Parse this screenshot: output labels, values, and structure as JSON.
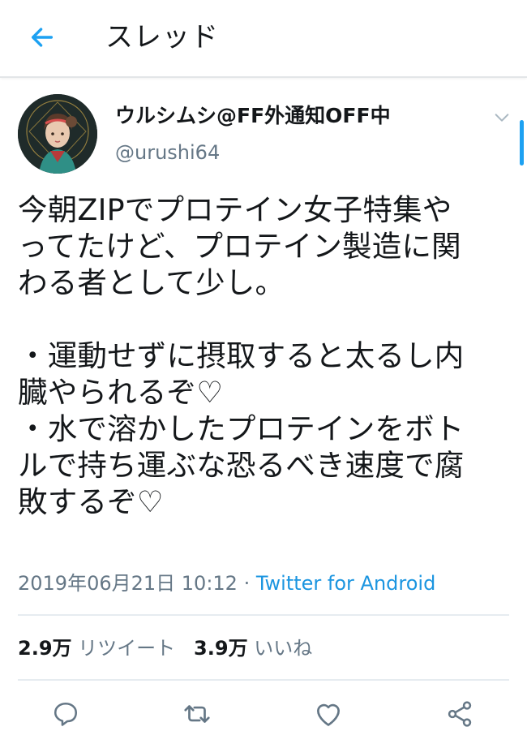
{
  "header": {
    "title": "スレッド",
    "back_icon": "arrow-left-icon"
  },
  "colors": {
    "accent": "#1da1f2",
    "link": "#1b95e0",
    "secondary_text": "#657786",
    "primary_text": "#14171a"
  },
  "tweet": {
    "author": {
      "display_name": "ウルシムシ@FF外通知OFF中",
      "handle": "@urushi64"
    },
    "text": "今朝ZIPでプロテイン女子特集や\nってたけど、プロテイン製造に関\nわる者として少し。\n\n・運動せずに摂取すると太るし内\n臓やられるぞ♡\n・水で溶かしたプロテインをボト\nルで持ち運ぶな恐るべき速度で腐\n敗するぞ♡",
    "timestamp": "2019年06月21日 10:12",
    "separator": " · ",
    "source": "Twitter for Android",
    "stats": {
      "retweets": "2.9万",
      "retweets_label": "リツイート",
      "likes": "3.9万",
      "likes_label": "いいね"
    }
  },
  "actions": [
    {
      "icon": "reply-icon"
    },
    {
      "icon": "retweet-icon"
    },
    {
      "icon": "heart-icon"
    },
    {
      "icon": "share-icon"
    }
  ]
}
